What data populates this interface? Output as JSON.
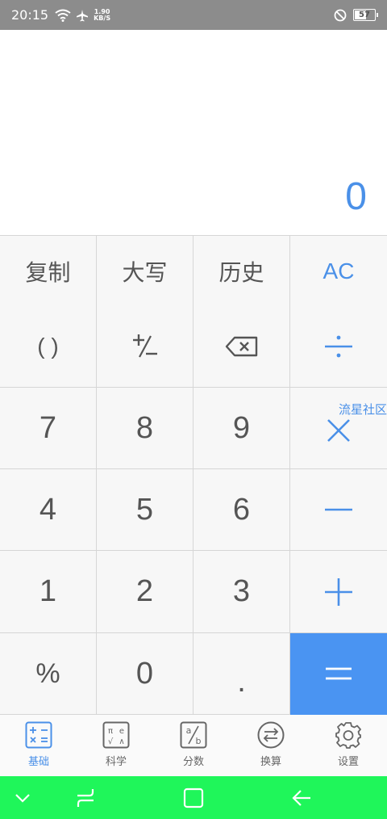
{
  "status_bar": {
    "time": "20:15",
    "net_speed_value": "1.90",
    "net_speed_unit": "KB/S",
    "battery": "57"
  },
  "display": {
    "value": "0"
  },
  "keys": {
    "row0": [
      "复制",
      "大写",
      "历史",
      "AC"
    ],
    "row2": [
      "7",
      "8",
      "9"
    ],
    "row3": [
      "4",
      "5",
      "6"
    ],
    "row4": [
      "1",
      "2",
      "3"
    ],
    "row5": [
      "%",
      "0",
      "."
    ],
    "parentheses": "( )"
  },
  "watermark": "流星社区",
  "tabs": [
    {
      "label": "基础",
      "icon": "basic-calc-icon",
      "active": true
    },
    {
      "label": "科学",
      "icon": "scientific-icon",
      "active": false
    },
    {
      "label": "分数",
      "icon": "fraction-icon",
      "active": false
    },
    {
      "label": "换算",
      "icon": "convert-icon",
      "active": false
    },
    {
      "label": "设置",
      "icon": "settings-icon",
      "active": false
    }
  ],
  "colors": {
    "accent": "#4a90e8",
    "equals_bg": "#4a94f2",
    "nav_bar": "#1ff65a",
    "status_bar": "#8c8c8c"
  }
}
